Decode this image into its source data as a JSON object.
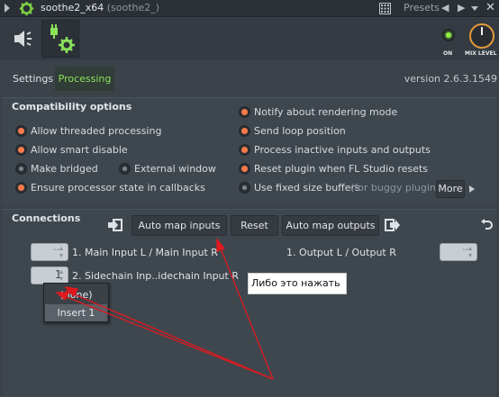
{
  "titlebar": {
    "title": "soothe2_x64",
    "subtitle": "(soothe2_)",
    "presets_label": "Presets",
    "prev_label": "◀",
    "next_label": "▶",
    "close_label": "✕"
  },
  "header": {
    "on_label": "ON",
    "mix_label": "MIX LEVEL",
    "on_state": true,
    "accent_color": "#8ef040",
    "knob_color": "#e69b3a"
  },
  "tabs": {
    "settings": "Settings",
    "processing": "Processing",
    "active": "Processing"
  },
  "version": "version 2.6.3.1549",
  "compatibility": {
    "title": "Compatibility options",
    "left": [
      {
        "label": "Allow threaded processing",
        "on": true
      },
      {
        "label": "Allow smart disable",
        "on": true
      },
      {
        "label": "Make bridged",
        "on": false
      },
      {
        "label": "External window",
        "on": false
      },
      {
        "label": "Ensure processor state in callbacks",
        "on": true
      }
    ],
    "right": [
      {
        "label": "Notify about rendering mode",
        "on": true
      },
      {
        "label": "Send loop position",
        "on": true
      },
      {
        "label": "Process inactive inputs and outputs",
        "on": true
      },
      {
        "label": "Reset plugin when FL Studio resets",
        "on": true
      },
      {
        "label": "Use fixed size buffers",
        "note": "(for buggy plugins)",
        "on": false
      }
    ],
    "more_label": "More"
  },
  "connections": {
    "title": "Connections",
    "auto_inputs_label": "Auto map inputs",
    "reset_label": "Reset",
    "auto_outputs_label": "Auto map outputs",
    "input1_label": "1. Main Input L / Main Input R",
    "input1_value": "---",
    "input2_label": "2. Sidechain Inp..idechain Input R",
    "input2_value": "1",
    "output1_label": "1. Output L / Output R",
    "output1_value": "---",
    "dropdown": [
      "(none)",
      "Insert 1"
    ],
    "dropdown_selected": "Insert 1"
  },
  "annotation": {
    "note": "Либо это нажать",
    "arrow_color": "#e0191e"
  }
}
